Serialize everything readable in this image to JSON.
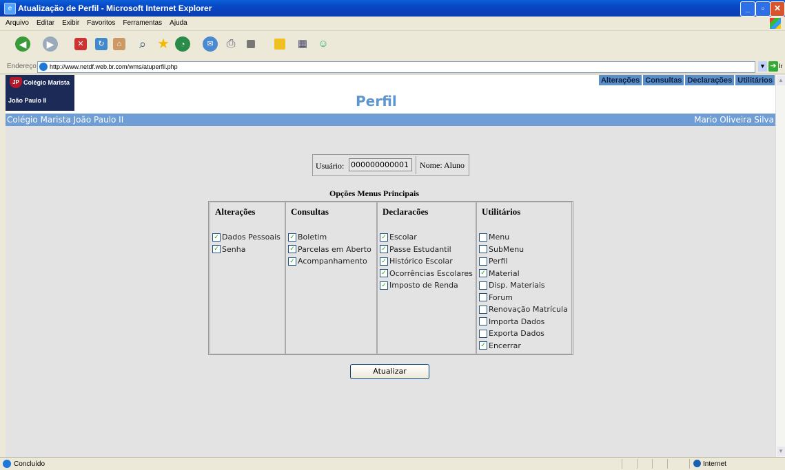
{
  "window": {
    "title": "Atualização de Perfil - Microsoft Internet Explorer"
  },
  "menu": [
    "Arquivo",
    "Editar",
    "Exibir",
    "Favoritos",
    "Ferramentas",
    "Ajuda"
  ],
  "address": {
    "label": "Endereço",
    "url": "http://www.netdf.web.br.com/wms/atuperfil.php",
    "go_label": "Ir"
  },
  "site": {
    "logo_line1": "Colégio Marista",
    "logo_line2": "João Paulo II",
    "title": "Perfil",
    "nav": [
      "Alterações",
      "Consultas",
      "Declarações",
      "Utilitários"
    ],
    "school": "Colégio Marista João Paulo II",
    "user_name": "Mario Oliveira Silva"
  },
  "form": {
    "usuario_label": "Usuário:",
    "usuario_value": "000000000001",
    "nome_label": "Nome: Aluno",
    "options_title": "Opções Menus Principais",
    "submit_label": "Atualizar"
  },
  "columns": [
    {
      "header": "Alterações",
      "items": [
        {
          "label": "Dados Pessoais",
          "checked": true
        },
        {
          "label": "Senha",
          "checked": true
        }
      ]
    },
    {
      "header": "Consultas",
      "items": [
        {
          "label": "Boletim",
          "checked": true
        },
        {
          "label": "Parcelas em Aberto",
          "checked": true
        },
        {
          "label": "Acompanhamento",
          "checked": true
        }
      ]
    },
    {
      "header": "Declaracões",
      "items": [
        {
          "label": "Escolar",
          "checked": true
        },
        {
          "label": "Passe Estudantil",
          "checked": true
        },
        {
          "label": "Histórico Escolar",
          "checked": true
        },
        {
          "label": "Ocorrências Escolares",
          "checked": true
        },
        {
          "label": "Imposto de Renda",
          "checked": true
        }
      ]
    },
    {
      "header": "Utilitários",
      "items": [
        {
          "label": "Menu",
          "checked": false
        },
        {
          "label": "SubMenu",
          "checked": false
        },
        {
          "label": "Perfil",
          "checked": false
        },
        {
          "label": "Material",
          "checked": true
        },
        {
          "label": "Disp. Materiais",
          "checked": false
        },
        {
          "label": "Forum",
          "checked": false
        },
        {
          "label": "Renovação Matrícula",
          "checked": false
        },
        {
          "label": "Importa Dados",
          "checked": false
        },
        {
          "label": "Exporta Dados",
          "checked": false
        },
        {
          "label": "Encerrar",
          "checked": true
        }
      ]
    }
  ],
  "status": {
    "text": "Concluído",
    "zone": "Internet"
  },
  "colors": {
    "accent": "#6f9ed6",
    "title": "#5d96cf",
    "nav": "#5b8fc7"
  }
}
